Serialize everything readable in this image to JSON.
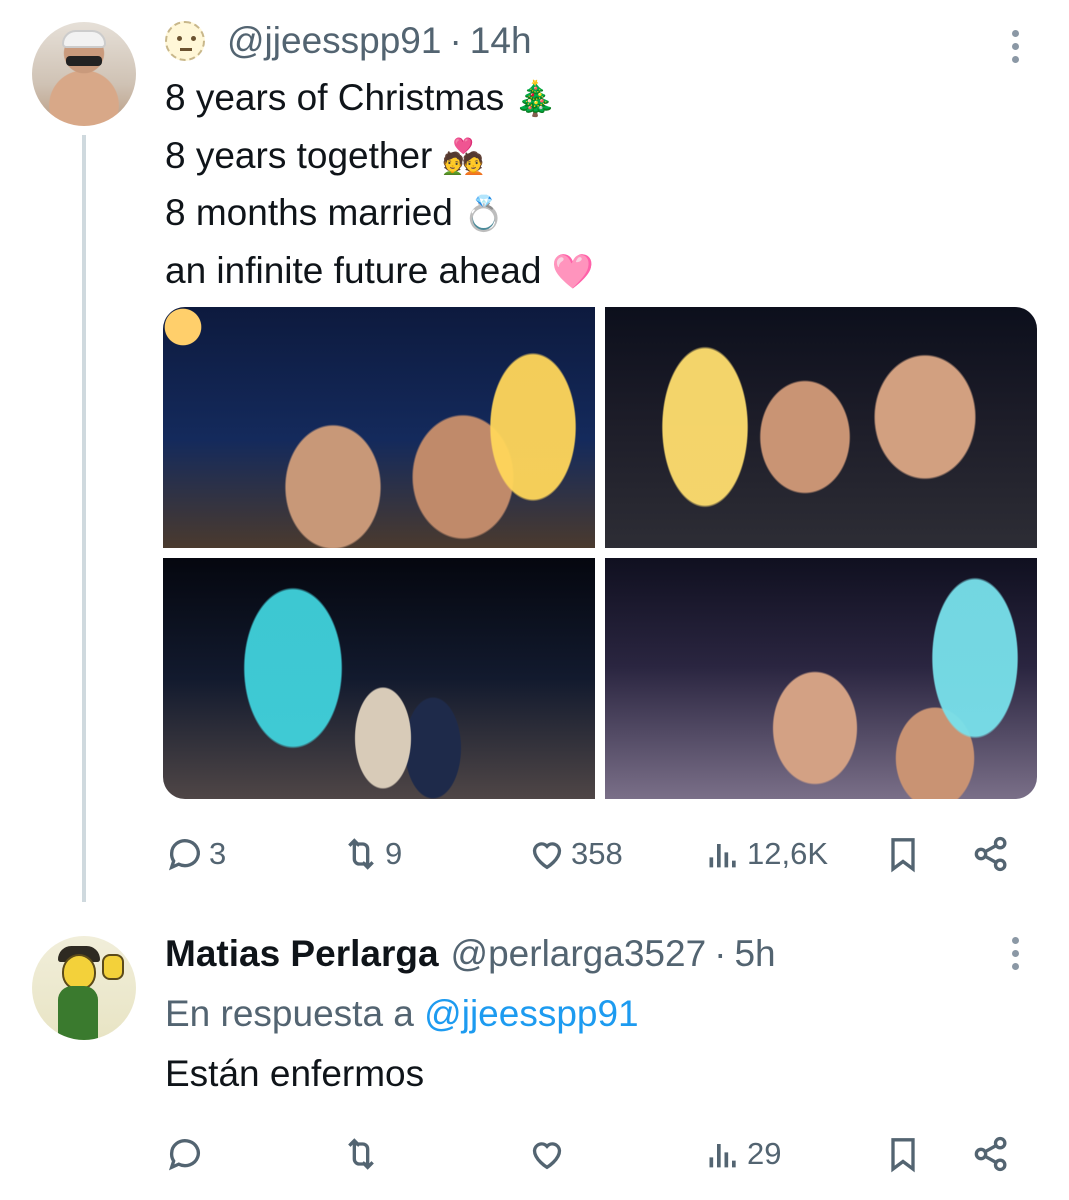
{
  "tweet": {
    "handle": "@jjeesspp91",
    "time": "14h",
    "lines": [
      "8 years of Christmas",
      "8 years together",
      "8 months married",
      "an infinite future ahead"
    ],
    "line_emojis": [
      "🎄",
      "💑",
      "💍",
      "🩷"
    ],
    "actions": {
      "replies": "3",
      "reposts": "9",
      "likes": "358",
      "views": "12,6K"
    }
  },
  "reply": {
    "name": "Matias Perlarga",
    "handle": "@perlarga3527",
    "time": "5h",
    "in_reply_prefix": "En respuesta a",
    "in_reply_mention": "@jjeesspp91",
    "text": "Están enfermos",
    "actions": {
      "views": "29"
    }
  },
  "separator": "·",
  "icons": {
    "reply": "comment-icon",
    "repost": "repost-icon",
    "like": "heart-icon",
    "views": "views-icon",
    "bookmark": "bookmark-icon",
    "share": "share-icon",
    "more": "more-icon"
  },
  "colors": {
    "text": "#0f1419",
    "secondary": "#536471",
    "link": "#1d9bf0",
    "thread_line": "#cfd9de"
  }
}
